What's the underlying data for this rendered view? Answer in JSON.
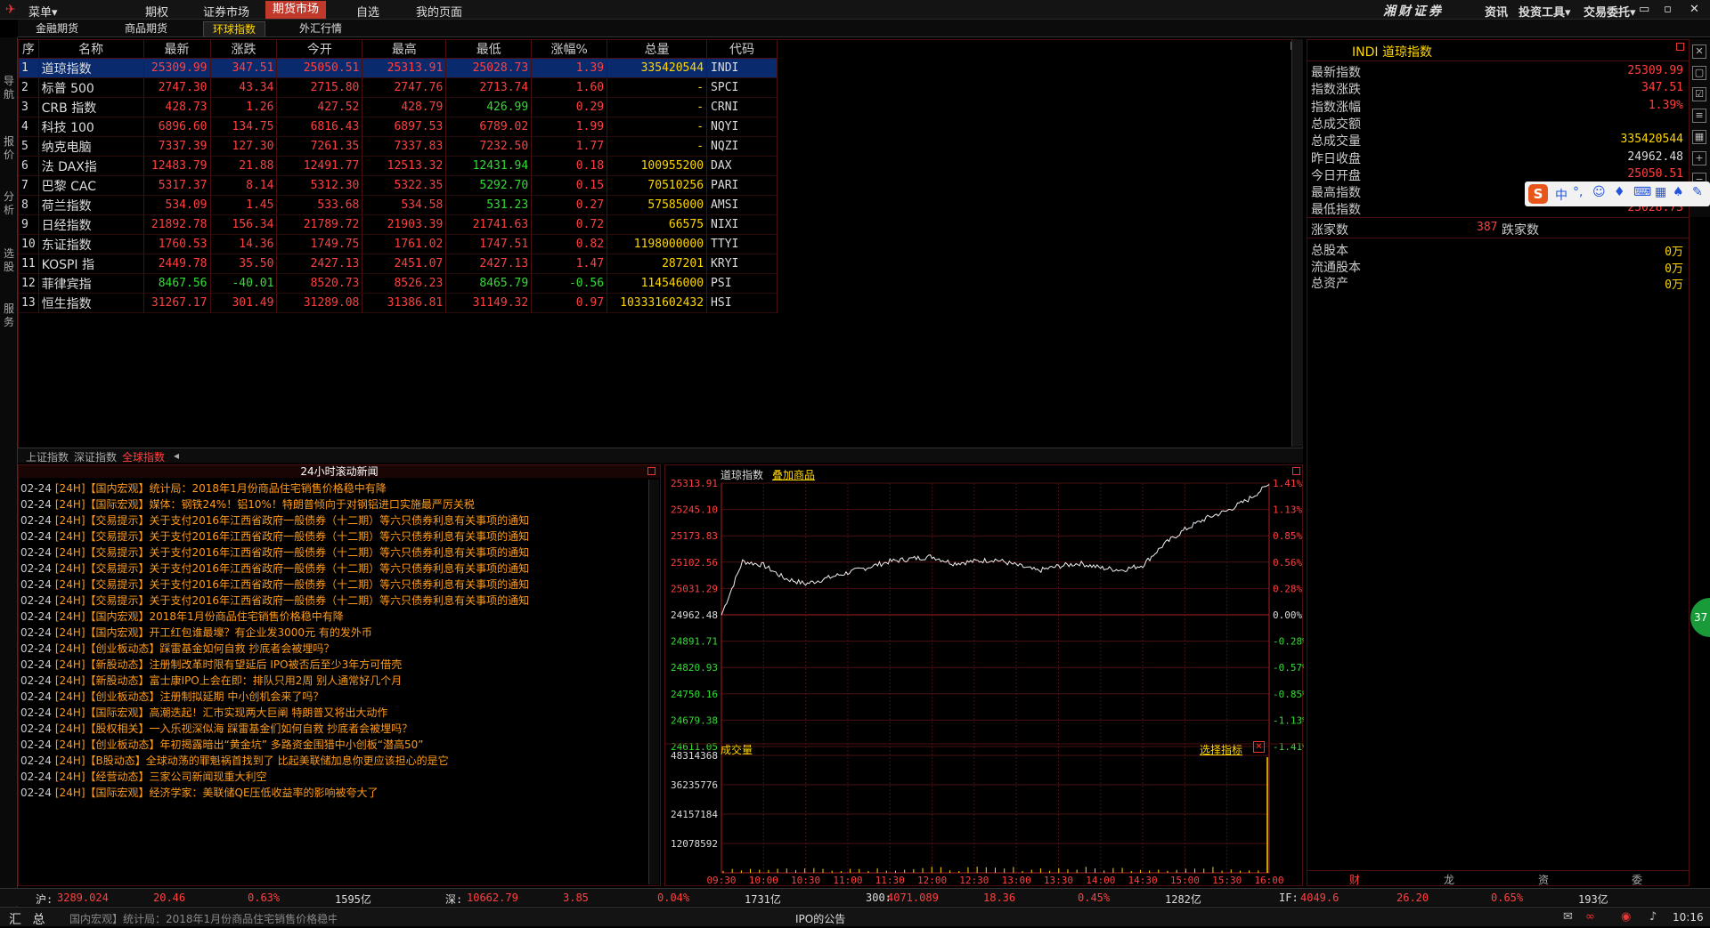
{
  "topbar": {
    "menu_label": "菜单▾",
    "tabs": [
      "期权",
      "证券市场",
      "期货市场",
      "自选",
      "我的页面"
    ],
    "active_tab": "期货市场",
    "brand": "湘财证券",
    "right_menus": [
      "资讯",
      "投资工具▾",
      "交易委托▾"
    ]
  },
  "subtabs": [
    "金融期货",
    "商品期货",
    "环球指数",
    "外汇行情"
  ],
  "active_subtab": "环球指数",
  "leftside": [
    "导航",
    "报价",
    "分析",
    "选股",
    "服务"
  ],
  "quote": {
    "headers": [
      "序",
      "名称",
      "最新",
      "涨跌",
      "今开",
      "最高",
      "最低",
      "涨幅%",
      "总量",
      "代码"
    ],
    "rows": [
      {
        "no": "1",
        "name": "道琼指数",
        "last": "25309.99",
        "chg": "347.51",
        "open": "25050.51",
        "high": "25313.91",
        "low": "25028.73",
        "pct": "1.39",
        "vol": "335420544",
        "code": "INDI"
      },
      {
        "no": "2",
        "name": "标普 500",
        "last": "2747.30",
        "chg": "43.34",
        "open": "2715.80",
        "high": "2747.76",
        "low": "2713.74",
        "pct": "1.60",
        "vol": "-",
        "code": "SPCI"
      },
      {
        "no": "3",
        "name": "CRB 指数",
        "last": "428.73",
        "chg": "1.26",
        "open": "427.52",
        "high": "428.79",
        "low": "426.99",
        "pct": "0.29",
        "vol": "-",
        "code": "CRNI"
      },
      {
        "no": "4",
        "name": "科技 100",
        "last": "6896.60",
        "chg": "134.75",
        "open": "6816.43",
        "high": "6897.53",
        "low": "6789.02",
        "pct": "1.99",
        "vol": "-",
        "code": "NQYI"
      },
      {
        "no": "5",
        "name": "纳克电脑",
        "last": "7337.39",
        "chg": "127.30",
        "open": "7261.35",
        "high": "7337.83",
        "low": "7232.50",
        "pct": "1.77",
        "vol": "-",
        "code": "NQZI"
      },
      {
        "no": "6",
        "name": "法 DAX指",
        "last": "12483.79",
        "chg": "21.88",
        "open": "12491.77",
        "high": "12513.32",
        "low": "12431.94",
        "pct": "0.18",
        "vol": "100955200",
        "code": "DAX"
      },
      {
        "no": "7",
        "name": "巴黎 CAC",
        "last": "5317.37",
        "chg": "8.14",
        "open": "5312.30",
        "high": "5322.35",
        "low": "5292.70",
        "pct": "0.15",
        "vol": "70510256",
        "code": "PARI"
      },
      {
        "no": "8",
        "name": "荷兰指数",
        "last": "534.09",
        "chg": "1.45",
        "open": "533.68",
        "high": "534.58",
        "low": "531.23",
        "pct": "0.27",
        "vol": "57585000",
        "code": "AMSI"
      },
      {
        "no": "9",
        "name": "日经指数",
        "last": "21892.78",
        "chg": "156.34",
        "open": "21789.72",
        "high": "21903.39",
        "low": "21741.63",
        "pct": "0.72",
        "vol": "66575",
        "code": "NIXI"
      },
      {
        "no": "10",
        "name": "东证指数",
        "last": "1760.53",
        "chg": "14.36",
        "open": "1749.75",
        "high": "1761.02",
        "low": "1747.51",
        "pct": "0.82",
        "vol": "1198000000",
        "code": "TTYI"
      },
      {
        "no": "11",
        "name": "KOSPI 指",
        "last": "2449.78",
        "chg": "35.50",
        "open": "2427.13",
        "high": "2451.07",
        "low": "2427.13",
        "pct": "1.47",
        "vol": "287201",
        "code": "KRYI"
      },
      {
        "no": "12",
        "name": "菲律宾指",
        "last": "8467.56",
        "chg": "-40.01",
        "open": "8520.73",
        "high": "8526.23",
        "low": "8465.79",
        "pct": "-0.56",
        "vol": "114546000",
        "code": "PSI"
      },
      {
        "no": "13",
        "name": "恒生指数",
        "last": "31267.17",
        "chg": "301.49",
        "open": "31289.08",
        "high": "31386.81",
        "low": "31149.32",
        "pct": "0.97",
        "vol": "103331602432",
        "code": "HSI"
      }
    ],
    "bottom_tabs": [
      "上证指数",
      "深证指数",
      "全球指数"
    ],
    "active_bottom_tab": "全球指数"
  },
  "right": {
    "title": "INDI 道琼指数",
    "items": [
      {
        "k": "最新指数",
        "v": "25309.99"
      },
      {
        "k": "指数涨跌",
        "v": "347.51"
      },
      {
        "k": "指数涨幅",
        "v": "1.39%"
      },
      {
        "k": "总成交额",
        "v": ""
      },
      {
        "k": "总成交量",
        "v": "335420544"
      },
      {
        "k": "昨日收盘",
        "v": "24962.48"
      },
      {
        "k": "今日开盘",
        "v": "25050.51"
      },
      {
        "k": "最高指数",
        "v": "25313.91"
      },
      {
        "k": "最低指数",
        "v": "25028.73"
      }
    ],
    "up_label": "涨家数",
    "up_value": "387",
    "down_label": "跌家数",
    "items2": [
      {
        "k": "总股本",
        "v": "0万"
      },
      {
        "k": "流通股本",
        "v": "0万"
      },
      {
        "k": "总资产",
        "v": "0万"
      }
    ],
    "bottom_tabs": [
      "财",
      "龙",
      "资",
      "委"
    ]
  },
  "news": {
    "title": "24小时滚动新闻",
    "items": [
      {
        "d": "02-24",
        "t": "[24H]【国内宏观】统计局：2018年1月份商品住宅销售价格稳中有降"
      },
      {
        "d": "02-24",
        "t": "[24H]【国际宏观】媒体：钢铁24%！铝10%！特朗普倾向于对钢铝进口实施最严厉关税"
      },
      {
        "d": "02-24",
        "t": "[24H]【交易提示】关于支付2016年江西省政府一般债券（十二期）等六只债券利息有关事项的通知"
      },
      {
        "d": "02-24",
        "t": "[24H]【交易提示】关于支付2016年江西省政府一般债券（十二期）等六只债券利息有关事项的通知"
      },
      {
        "d": "02-24",
        "t": "[24H]【交易提示】关于支付2016年江西省政府一般债券（十二期）等六只债券利息有关事项的通知"
      },
      {
        "d": "02-24",
        "t": "[24H]【交易提示】关于支付2016年江西省政府一般债券（十二期）等六只债券利息有关事项的通知"
      },
      {
        "d": "02-24",
        "t": "[24H]【交易提示】关于支付2016年江西省政府一般债券（十二期）等六只债券利息有关事项的通知"
      },
      {
        "d": "02-24",
        "t": "[24H]【交易提示】关于支付2016年江西省政府一般债券（十二期）等六只债券利息有关事项的通知"
      },
      {
        "d": "02-24",
        "t": "[24H]【国内宏观】2018年1月份商品住宅销售价格稳中有降"
      },
      {
        "d": "02-24",
        "t": "[24H]【国内宏观】开工红包谁最壕？有企业发3000元 有的发外币"
      },
      {
        "d": "02-24",
        "t": "[24H]【创业板动态】踩雷基金如何自救 抄底者会被埋吗？"
      },
      {
        "d": "02-24",
        "t": "[24H]【新股动态】注册制改革时限有望延后 IPO被否后至少3年方可借壳"
      },
      {
        "d": "02-24",
        "t": "[24H]【新股动态】富士康IPO上会在即：排队只用2周 别人通常好几个月"
      },
      {
        "d": "02-24",
        "t": "[24H]【创业板动态】注册制拟延期 中小创机会来了吗？"
      },
      {
        "d": "02-24",
        "t": "[24H]【国际宏观】高潮迭起！汇市实现两大巨阐 特朗普又将出大动作"
      },
      {
        "d": "02-24",
        "t": "[24H]【股权相关】一入乐视深似海 踩雷基金们如何自救 抄底者会被埋吗？"
      },
      {
        "d": "02-24",
        "t": "[24H]【创业板动态】年初揭露暗出“黄金坑” 多路资金围猎中小创板“潜高50”"
      },
      {
        "d": "02-24",
        "t": "[24H]【B股动态】全球动荡的罪魁祸首找到了 比起美联储加息你更应该担心的是它"
      },
      {
        "d": "02-24",
        "t": "[24H]【经营动态】三家公司新闻现重大利空"
      },
      {
        "d": "02-24",
        "t": "[24H]【国际宏观】经济学家：美联储QE压低收益率的影响被夸大了"
      }
    ]
  },
  "chart": {
    "name": "道琼指数",
    "add_label": "叠加商品",
    "volume_label": "成交量",
    "select_label": "选择指标",
    "price_left": [
      "25313.91",
      "25245.10",
      "25173.83",
      "25102.56",
      "25031.29",
      "24962.48",
      "24891.71",
      "24820.93",
      "24750.16",
      "24679.38",
      "24611.05"
    ],
    "pct_right": [
      "1.41%",
      "1.13%",
      "0.85%",
      "0.56%",
      "0.28%",
      "0.00%",
      "-0.28%",
      "-0.57%",
      "-0.85%",
      "-1.13%",
      "-1.41%"
    ],
    "vol_left": [
      "48314368",
      "36235776",
      "24157184",
      "12078592"
    ],
    "times": [
      "09:30",
      "10:00",
      "10:30",
      "11:00",
      "11:30",
      "12:00",
      "12:30",
      "13:00",
      "13:30",
      "14:00",
      "14:30",
      "15:00",
      "15:30",
      "16:00"
    ]
  },
  "chart_data": {
    "type": "line",
    "title": "道琼指数",
    "xlabel": "",
    "ylabel": "",
    "prev_close": 24962.48,
    "ylim": [
      24611.05,
      25313.91
    ],
    "x": [
      "09:30",
      "09:45",
      "10:00",
      "10:15",
      "10:30",
      "10:45",
      "11:00",
      "11:15",
      "11:30",
      "11:45",
      "12:00",
      "12:15",
      "12:30",
      "12:45",
      "13:00",
      "13:15",
      "13:30",
      "13:45",
      "14:00",
      "14:15",
      "14:30",
      "14:45",
      "15:00",
      "15:15",
      "15:30",
      "15:45",
      "16:00"
    ],
    "series": [
      {
        "name": "道琼指数",
        "values": [
          24962,
          25105,
          25095,
          25060,
          25045,
          25060,
          25075,
          25090,
          25105,
          25112,
          25118,
          25100,
          25105,
          25110,
          25095,
          25080,
          25092,
          25100,
          25088,
          25082,
          25095,
          25150,
          25190,
          25220,
          25240,
          25270,
          25310
        ]
      }
    ]
  },
  "statusbar": [
    {
      "k": "沪:",
      "v": "3289.024",
      "c": "20.46",
      "p": "0.63%",
      "a": "1595亿"
    },
    {
      "k": "深:",
      "v": "10662.79",
      "c": "3.85",
      "p": "0.04%",
      "a": "1731亿"
    },
    {
      "k": "300:",
      "v": "4071.089",
      "c": "18.36",
      "p": "0.45%",
      "a": "1282亿"
    },
    {
      "k": "IF:",
      "v": "4049.6",
      "c": "26.20",
      "p": "0.65%",
      "a": "193亿"
    }
  ],
  "bottombar": {
    "summary": "汇 总",
    "ticker": "国内宏观】统计局：2018年1月份商品住宅销售价格稳中有降",
    "notice": "IPO的公告",
    "time": "10:16"
  },
  "ime": {
    "label": "中",
    "float_value": "37"
  }
}
